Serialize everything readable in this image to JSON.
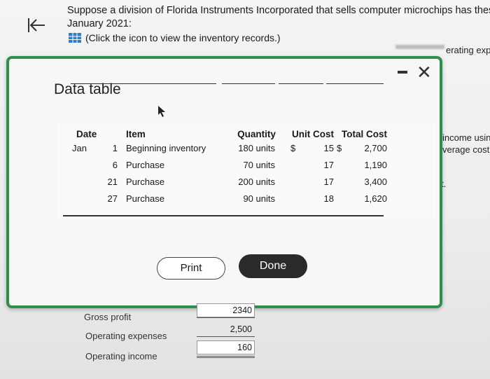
{
  "question": {
    "line1": "Suppose a division of Florida Instruments Incorporated that sells computer microchips has these inv",
    "line2": "January 2021:",
    "help_link": "(Click the icon to view the inventory records.)"
  },
  "right_fragments": {
    "top": "erating exp",
    "mid1": "income usin",
    "mid2": "verage cost",
    "mid3": "t."
  },
  "modal": {
    "title": "Data table",
    "table": {
      "headers": [
        "Date",
        "Item",
        "Quantity",
        "Unit Cost",
        "Total Cost"
      ],
      "rows": [
        {
          "month": "Jan",
          "day": "1",
          "item": "Beginning inventory",
          "quantity": "180 units",
          "dollar1": "$",
          "unit_cost": "15",
          "dollar2": "$",
          "total_cost": "2,700"
        },
        {
          "month": "",
          "day": "6",
          "item": "Purchase",
          "quantity": "70 units",
          "dollar1": "",
          "unit_cost": "17",
          "dollar2": "",
          "total_cost": "1,190"
        },
        {
          "month": "",
          "day": "21",
          "item": "Purchase",
          "quantity": "200 units",
          "dollar1": "",
          "unit_cost": "17",
          "dollar2": "",
          "total_cost": "3,400"
        },
        {
          "month": "",
          "day": "27",
          "item": "Purchase",
          "quantity": "90 units",
          "dollar1": "",
          "unit_cost": "18",
          "dollar2": "",
          "total_cost": "1,620"
        }
      ]
    },
    "print_label": "Print",
    "done_label": "Done"
  },
  "below": {
    "gross_profit_label": "Gross profit",
    "gross_profit_value": "2340",
    "operating_expenses_label": "Operating expenses",
    "operating_expenses_value": "2,500",
    "operating_income_label": "Operating income",
    "operating_income_value": "160"
  },
  "colors": {
    "modal_border": "#2e8f4a",
    "done_button": "#2a2a2a",
    "grid_icon": "#2f7fc4"
  }
}
